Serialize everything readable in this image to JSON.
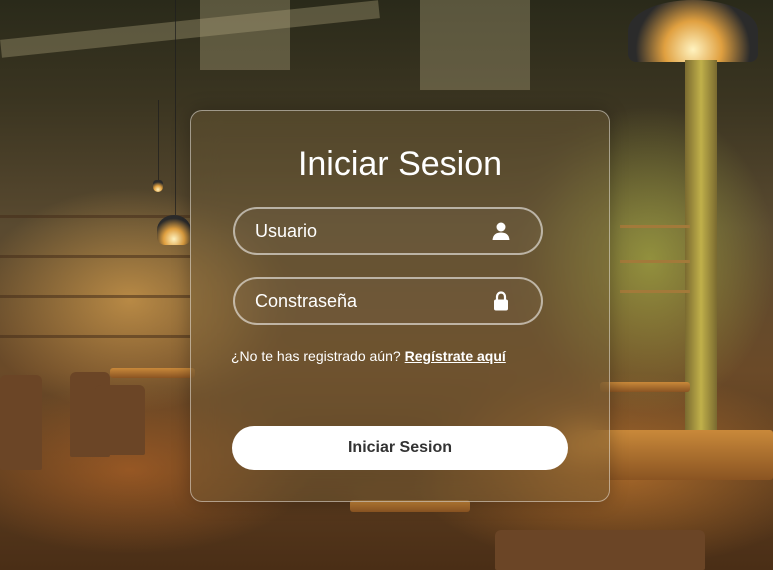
{
  "login": {
    "title": "Iniciar Sesion",
    "username_placeholder": "Usuario",
    "username_icon": "user-icon",
    "password_placeholder": "Constraseña",
    "password_icon": "lock-icon",
    "register_prompt": "¿No te has registrado aún?",
    "register_link": "Regístrate aquí",
    "submit_label": "Iniciar Sesion"
  },
  "colors": {
    "text": "#ffffff",
    "button_bg": "#ffffff",
    "button_text": "#333333"
  }
}
